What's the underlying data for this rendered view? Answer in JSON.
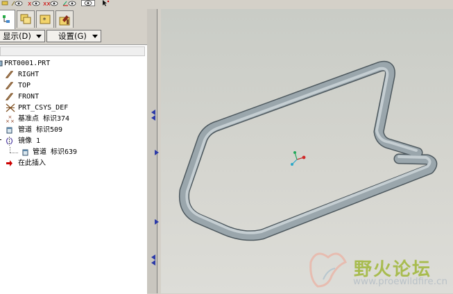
{
  "navigator": {
    "show_label": "显示(D)",
    "settings_label": "设置(G)"
  },
  "model_tree": {
    "root": "PRT0001.PRT",
    "items": [
      {
        "label": "RIGHT",
        "icon": "datum-plane-icon"
      },
      {
        "label": "TOP",
        "icon": "datum-plane-icon"
      },
      {
        "label": "FRONT",
        "icon": "datum-plane-icon"
      },
      {
        "label": "PRT_CSYS_DEF",
        "icon": "coordinate-system-icon"
      },
      {
        "label": "基准点 标识374",
        "icon": "datum-point-icon"
      },
      {
        "label": "管道 标识509",
        "icon": "pipe-feature-icon"
      },
      {
        "label": "镜像 1",
        "icon": "mirror-icon"
      },
      {
        "label": "管道 标识639",
        "icon": "pipe-feature-icon"
      },
      {
        "label": "在此插入",
        "icon": "insert-here-arrow-icon"
      }
    ]
  },
  "watermark": {
    "title": "野火论坛",
    "url": "www.proewildfire.cn"
  },
  "colors": {
    "viewport_bg": "#d5d5cf",
    "pipe": "#9ba7ad",
    "tree_bg": "#ffffff",
    "insert_arrow": "#cc0000",
    "panel_bg": "#d4d0c8"
  }
}
